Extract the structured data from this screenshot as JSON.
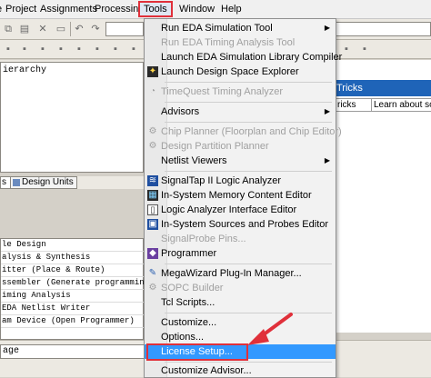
{
  "menubar": {
    "items": [
      "Project",
      "Assignments",
      "Processing",
      "Tools",
      "Window",
      "Help"
    ],
    "edge_left": "e"
  },
  "left_pane": {
    "hierarchy_label": "ierarchy",
    "tabs": [
      "s",
      "Design Units"
    ],
    "tasks": [
      "le Design",
      "alysis & Synthesis",
      "itter (Place & Route)",
      "ssembler (Generate programming file",
      "iming Analysis",
      "EDA Netlist Writer",
      "am Device (Open Programmer)"
    ],
    "status_text": "age"
  },
  "right_pane": {
    "header": "Tricks",
    "cells": [
      "ricks",
      "Learn about some"
    ]
  },
  "tools_menu": {
    "items": [
      {
        "label": "Run EDA Simulation Tool",
        "enabled": true,
        "icon": "",
        "submenu": true
      },
      {
        "label": "Run EDA Timing Analysis Tool",
        "enabled": false,
        "icon": "",
        "submenu": false
      },
      {
        "label": "Launch EDA Simulation Library Compiler",
        "enabled": true,
        "icon": "",
        "submenu": false
      },
      {
        "label": "Launch Design Space Explorer",
        "enabled": true,
        "icon": "dse-icon",
        "submenu": false
      },
      {
        "label": "TimeQuest Timing Analyzer",
        "enabled": false,
        "icon": "timequest-icon",
        "submenu": false
      },
      {
        "label": "Advisors",
        "enabled": true,
        "icon": "",
        "submenu": true
      },
      {
        "label": "Chip Planner (Floorplan and Chip Editor)",
        "enabled": false,
        "icon": "chip-planner-icon",
        "submenu": false
      },
      {
        "label": "Design Partition Planner",
        "enabled": false,
        "icon": "partition-planner-icon",
        "submenu": false
      },
      {
        "label": "Netlist Viewers",
        "enabled": true,
        "icon": "",
        "submenu": true
      },
      {
        "label": "SignalTap II Logic Analyzer",
        "enabled": true,
        "icon": "signaltap-icon",
        "submenu": false
      },
      {
        "label": "In-System Memory Content Editor",
        "enabled": true,
        "icon": "memory-editor-icon",
        "submenu": false
      },
      {
        "label": "Logic Analyzer Interface Editor",
        "enabled": true,
        "icon": "lai-editor-icon",
        "submenu": false
      },
      {
        "label": "In-System Sources and Probes Editor",
        "enabled": true,
        "icon": "sources-probes-icon",
        "submenu": false
      },
      {
        "label": "SignalProbe Pins...",
        "enabled": false,
        "icon": "",
        "submenu": false
      },
      {
        "label": "Programmer",
        "enabled": true,
        "icon": "programmer-icon",
        "submenu": false
      },
      {
        "label": "MegaWizard Plug-In Manager...",
        "enabled": true,
        "icon": "megawizard-icon",
        "submenu": false
      },
      {
        "label": "SOPC Builder",
        "enabled": false,
        "icon": "sopc-icon",
        "submenu": false
      },
      {
        "label": "Tcl Scripts...",
        "enabled": true,
        "icon": "",
        "submenu": false
      },
      {
        "label": "Customize...",
        "enabled": true,
        "icon": "",
        "submenu": false
      },
      {
        "label": "Options...",
        "enabled": true,
        "icon": "",
        "submenu": false
      },
      {
        "label": "License Setup...",
        "enabled": true,
        "icon": "",
        "submenu": false
      },
      {
        "label": "Customize Advisor...",
        "enabled": true,
        "icon": "",
        "submenu": false
      }
    ],
    "highlighted": "License Setup...",
    "accent_color": "#3399ff",
    "annotation_color": "#e0303a"
  }
}
